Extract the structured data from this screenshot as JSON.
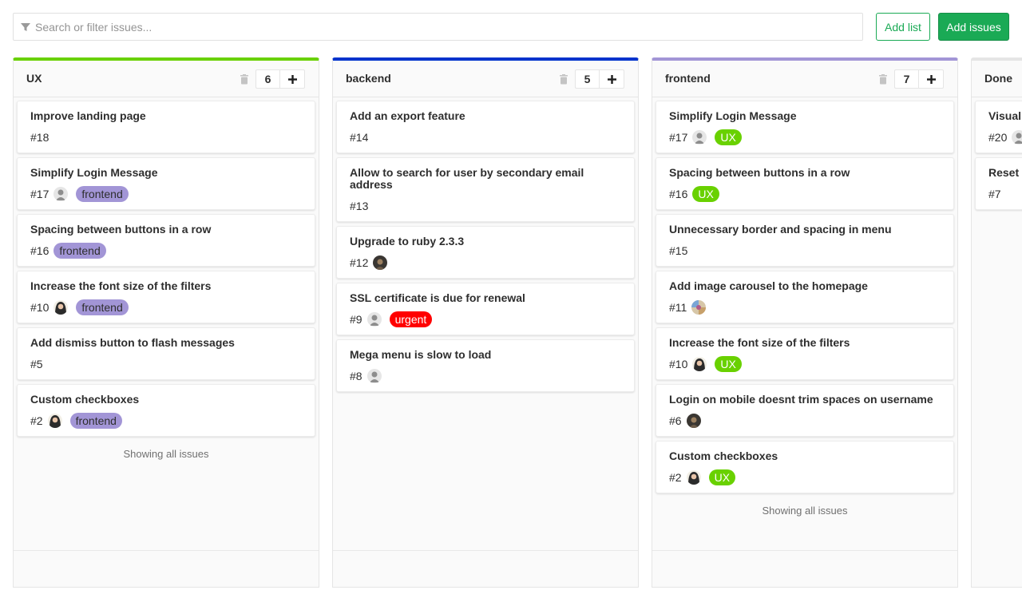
{
  "search": {
    "placeholder": "Search or filter issues..."
  },
  "buttons": {
    "add_list": "Add list",
    "add_issues": "Add issues"
  },
  "colors": {
    "ux": "#69d100",
    "backend": "#0033cc",
    "frontend": "#a295d6",
    "done": "#e5e5e5",
    "urgent": "#ff0000",
    "primary": "#1aaa55"
  },
  "footer_text": "Showing all issues",
  "lists": [
    {
      "title": "UX",
      "count": "6",
      "cards": [
        {
          "title": "Improve landing page",
          "number": "#18"
        },
        {
          "title": "Simplify Login Message",
          "number": "#17",
          "avatar": "avatar-gray",
          "label": "frontend"
        },
        {
          "title": "Spacing between buttons in a row",
          "number": "#16",
          "label": "frontend"
        },
        {
          "title": "Increase the font size of the filters",
          "number": "#10",
          "avatar": "avatar-woman",
          "label": "frontend"
        },
        {
          "title": "Add dismiss button to flash messages",
          "number": "#5"
        },
        {
          "title": "Custom checkboxes",
          "number": "#2",
          "avatar": "avatar-woman",
          "label": "frontend"
        }
      ]
    },
    {
      "title": "backend",
      "count": "5",
      "cards": [
        {
          "title": "Add an export feature",
          "number": "#14"
        },
        {
          "title": "Allow to search for user by secondary email address",
          "number": "#13"
        },
        {
          "title": "Upgrade to ruby 2.3.3",
          "number": "#12",
          "avatar": "avatar-dark"
        },
        {
          "title": "SSL certificate is due for renewal",
          "number": "#9",
          "avatar": "avatar-gray",
          "label": "urgent"
        },
        {
          "title": "Mega menu is slow to load",
          "number": "#8",
          "avatar": "avatar-gray"
        }
      ]
    },
    {
      "title": "frontend",
      "count": "7",
      "cards": [
        {
          "title": "Simplify Login Message",
          "number": "#17",
          "avatar": "avatar-gray",
          "label": "UX"
        },
        {
          "title": "Spacing between buttons in a row",
          "number": "#16",
          "label": "UX"
        },
        {
          "title": "Unnecessary border and spacing in menu",
          "number": "#15"
        },
        {
          "title": "Add image carousel to the homepage",
          "number": "#11",
          "avatar": "avatar-colorful"
        },
        {
          "title": "Increase the font size of the filters",
          "number": "#10",
          "avatar": "avatar-woman",
          "label": "UX"
        },
        {
          "title": "Login on mobile doesnt trim spaces on username",
          "number": "#6",
          "avatar": "avatar-dark"
        },
        {
          "title": "Custom checkboxes",
          "number": "#2",
          "avatar": "avatar-woman",
          "label": "UX"
        }
      ]
    },
    {
      "title": "Done",
      "cards": [
        {
          "title": "Visual",
          "number": "#20",
          "avatar": "avatar-gray"
        },
        {
          "title": "Reset",
          "number": "#7"
        }
      ]
    }
  ]
}
